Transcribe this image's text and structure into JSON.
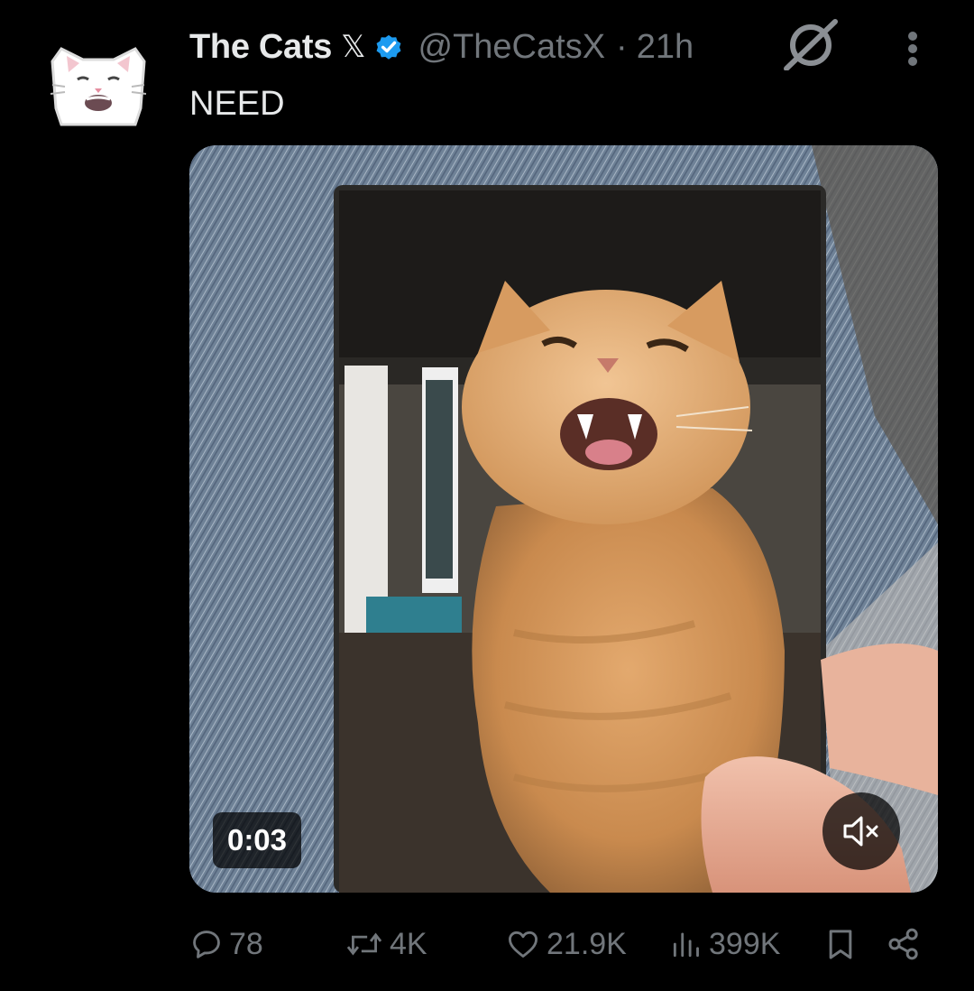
{
  "tweet": {
    "author_name": "The Cats",
    "x_badge": "𝕏",
    "handle": "@TheCatsX",
    "separator": "·",
    "time": "21h",
    "text": "NEED"
  },
  "media": {
    "duration": "0:03",
    "mute_icon": "speaker-muted-icon"
  },
  "actions": {
    "replies": "78",
    "reposts": "4K",
    "likes": "21.9K",
    "views": "399K"
  },
  "colors": {
    "background": "#000000",
    "text_primary": "#e7e9ea",
    "text_secondary": "#71767b",
    "verified_blue": "#1d9bf0"
  }
}
